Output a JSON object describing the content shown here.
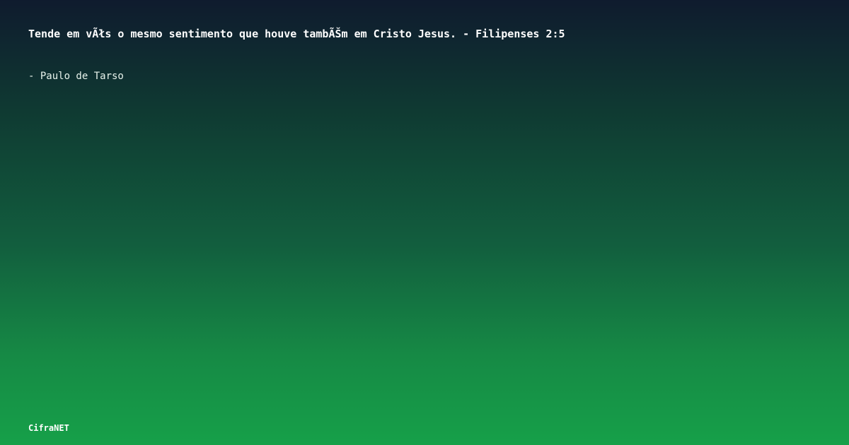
{
  "quote": {
    "text": "Tende em vÃłs o mesmo sentimento que houve tambÃŠm em Cristo Jesus. - Filipenses 2:5",
    "author": "- Paulo de Tarso"
  },
  "brand": {
    "name": "CifraNET"
  },
  "colors": {
    "gradient_top": "#0f1b2e",
    "gradient_bottom": "#16a049",
    "text": "#ffffff"
  }
}
